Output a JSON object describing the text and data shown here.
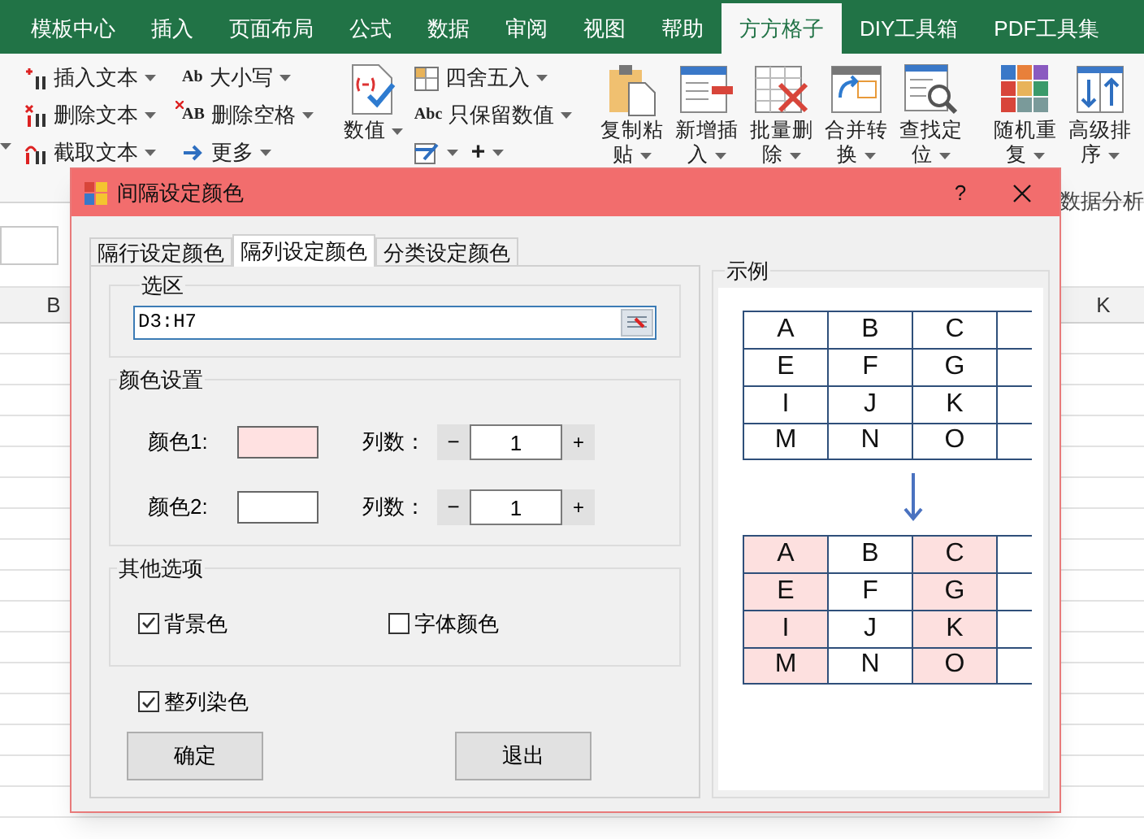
{
  "ribbon_tabs": [
    {
      "label": "模板中心",
      "selected": false
    },
    {
      "label": "插入",
      "selected": false
    },
    {
      "label": "页面布局",
      "selected": false
    },
    {
      "label": "公式",
      "selected": false
    },
    {
      "label": "数据",
      "selected": false
    },
    {
      "label": "审阅",
      "selected": false
    },
    {
      "label": "视图",
      "selected": false
    },
    {
      "label": "帮助",
      "selected": false
    },
    {
      "label": "方方格子",
      "selected": true
    },
    {
      "label": "DIY工具箱",
      "selected": false
    },
    {
      "label": "PDF工具集",
      "selected": false
    }
  ],
  "ribbon_groups": [
    {
      "rows": [
        [
          {
            "kind": "insert",
            "label": "插入文本"
          }
        ],
        [
          {
            "kind": "delete",
            "label": "删除文本"
          }
        ],
        [
          {
            "kind": "cut",
            "label": "截取文本"
          }
        ]
      ]
    },
    {
      "rows": [
        [
          {
            "kind": "badge",
            "icon_text": "Ab",
            "label": "大小写"
          }
        ],
        [
          {
            "kind": "badge-x",
            "icon_text": "AB",
            "label": "删除空格"
          }
        ],
        [
          {
            "kind": "arrow",
            "label": "更多"
          }
        ]
      ]
    },
    {
      "big": [
        {
          "kind": "value",
          "label": "数值"
        }
      ],
      "rows": [
        [
          {
            "kind": "round",
            "label": "四舍五入"
          }
        ],
        [
          {
            "kind": "badge",
            "icon_text": "Abc",
            "label": "只保留数值"
          }
        ],
        [
          {
            "kind": "pencil"
          },
          {
            "kind": "plain",
            "label": "+"
          }
        ]
      ]
    },
    {
      "big": [
        {
          "kind": "clipboard",
          "label": "复制粘贴"
        },
        {
          "kind": "form",
          "label": "新增插入"
        },
        {
          "kind": "grid-x",
          "label": "批量删除"
        },
        {
          "kind": "sync",
          "label": "合并转换"
        },
        {
          "kind": "find",
          "label": "查找定位"
        }
      ]
    },
    {
      "big": [
        {
          "kind": "tiles",
          "label": "随机重复"
        },
        {
          "kind": "sort",
          "label": "高级排序"
        }
      ]
    }
  ],
  "ribbon_group_label": "数据分析",
  "sheet": {
    "column_headers": [
      "B",
      "K"
    ]
  },
  "dialog": {
    "title": "间隔设定颜色",
    "help": "?",
    "tabs": [
      {
        "label": "隔行设定颜色",
        "selected": false
      },
      {
        "label": "隔列设定颜色",
        "selected": true
      },
      {
        "label": "分类设定颜色",
        "selected": false
      }
    ],
    "selection": {
      "title": "选区",
      "value": "D3:H7"
    },
    "colors": {
      "title": "颜色设置",
      "rows": [
        {
          "label": "颜色1:",
          "color": "#ffe1e1",
          "count_label": "列数：",
          "minus": "−",
          "value": "1",
          "plus": "+"
        },
        {
          "label": "颜色2:",
          "color": "#ffffff",
          "count_label": "列数：",
          "minus": "−",
          "value": "1",
          "plus": "+"
        }
      ]
    },
    "other": {
      "title": "其他选项",
      "checkboxes": [
        {
          "label": "背景色",
          "checked": true
        },
        {
          "label": "字体颜色",
          "checked": false
        }
      ]
    },
    "whole_column": {
      "label": "整列染色",
      "checked": true
    },
    "buttons": [
      "确定",
      "退出"
    ],
    "example": {
      "title": "示例",
      "before": [
        [
          {
            "text": "A",
            "shaded": false
          },
          {
            "text": "B",
            "shaded": false
          },
          {
            "text": "C",
            "shaded": false
          }
        ],
        [
          {
            "text": "E",
            "shaded": false
          },
          {
            "text": "F",
            "shaded": false
          },
          {
            "text": "G",
            "shaded": false
          }
        ],
        [
          {
            "text": "I",
            "shaded": false
          },
          {
            "text": "J",
            "shaded": false
          },
          {
            "text": "K",
            "shaded": false
          }
        ],
        [
          {
            "text": "M",
            "shaded": false
          },
          {
            "text": "N",
            "shaded": false
          },
          {
            "text": "O",
            "shaded": false
          }
        ]
      ],
      "after": [
        [
          {
            "text": "A",
            "shaded": true
          },
          {
            "text": "B",
            "shaded": false
          },
          {
            "text": "C",
            "shaded": true
          }
        ],
        [
          {
            "text": "E",
            "shaded": true
          },
          {
            "text": "F",
            "shaded": false
          },
          {
            "text": "G",
            "shaded": true
          }
        ],
        [
          {
            "text": "I",
            "shaded": true
          },
          {
            "text": "J",
            "shaded": false
          },
          {
            "text": "K",
            "shaded": true
          }
        ],
        [
          {
            "text": "M",
            "shaded": true
          },
          {
            "text": "N",
            "shaded": false
          },
          {
            "text": "O",
            "shaded": true
          }
        ]
      ]
    }
  }
}
